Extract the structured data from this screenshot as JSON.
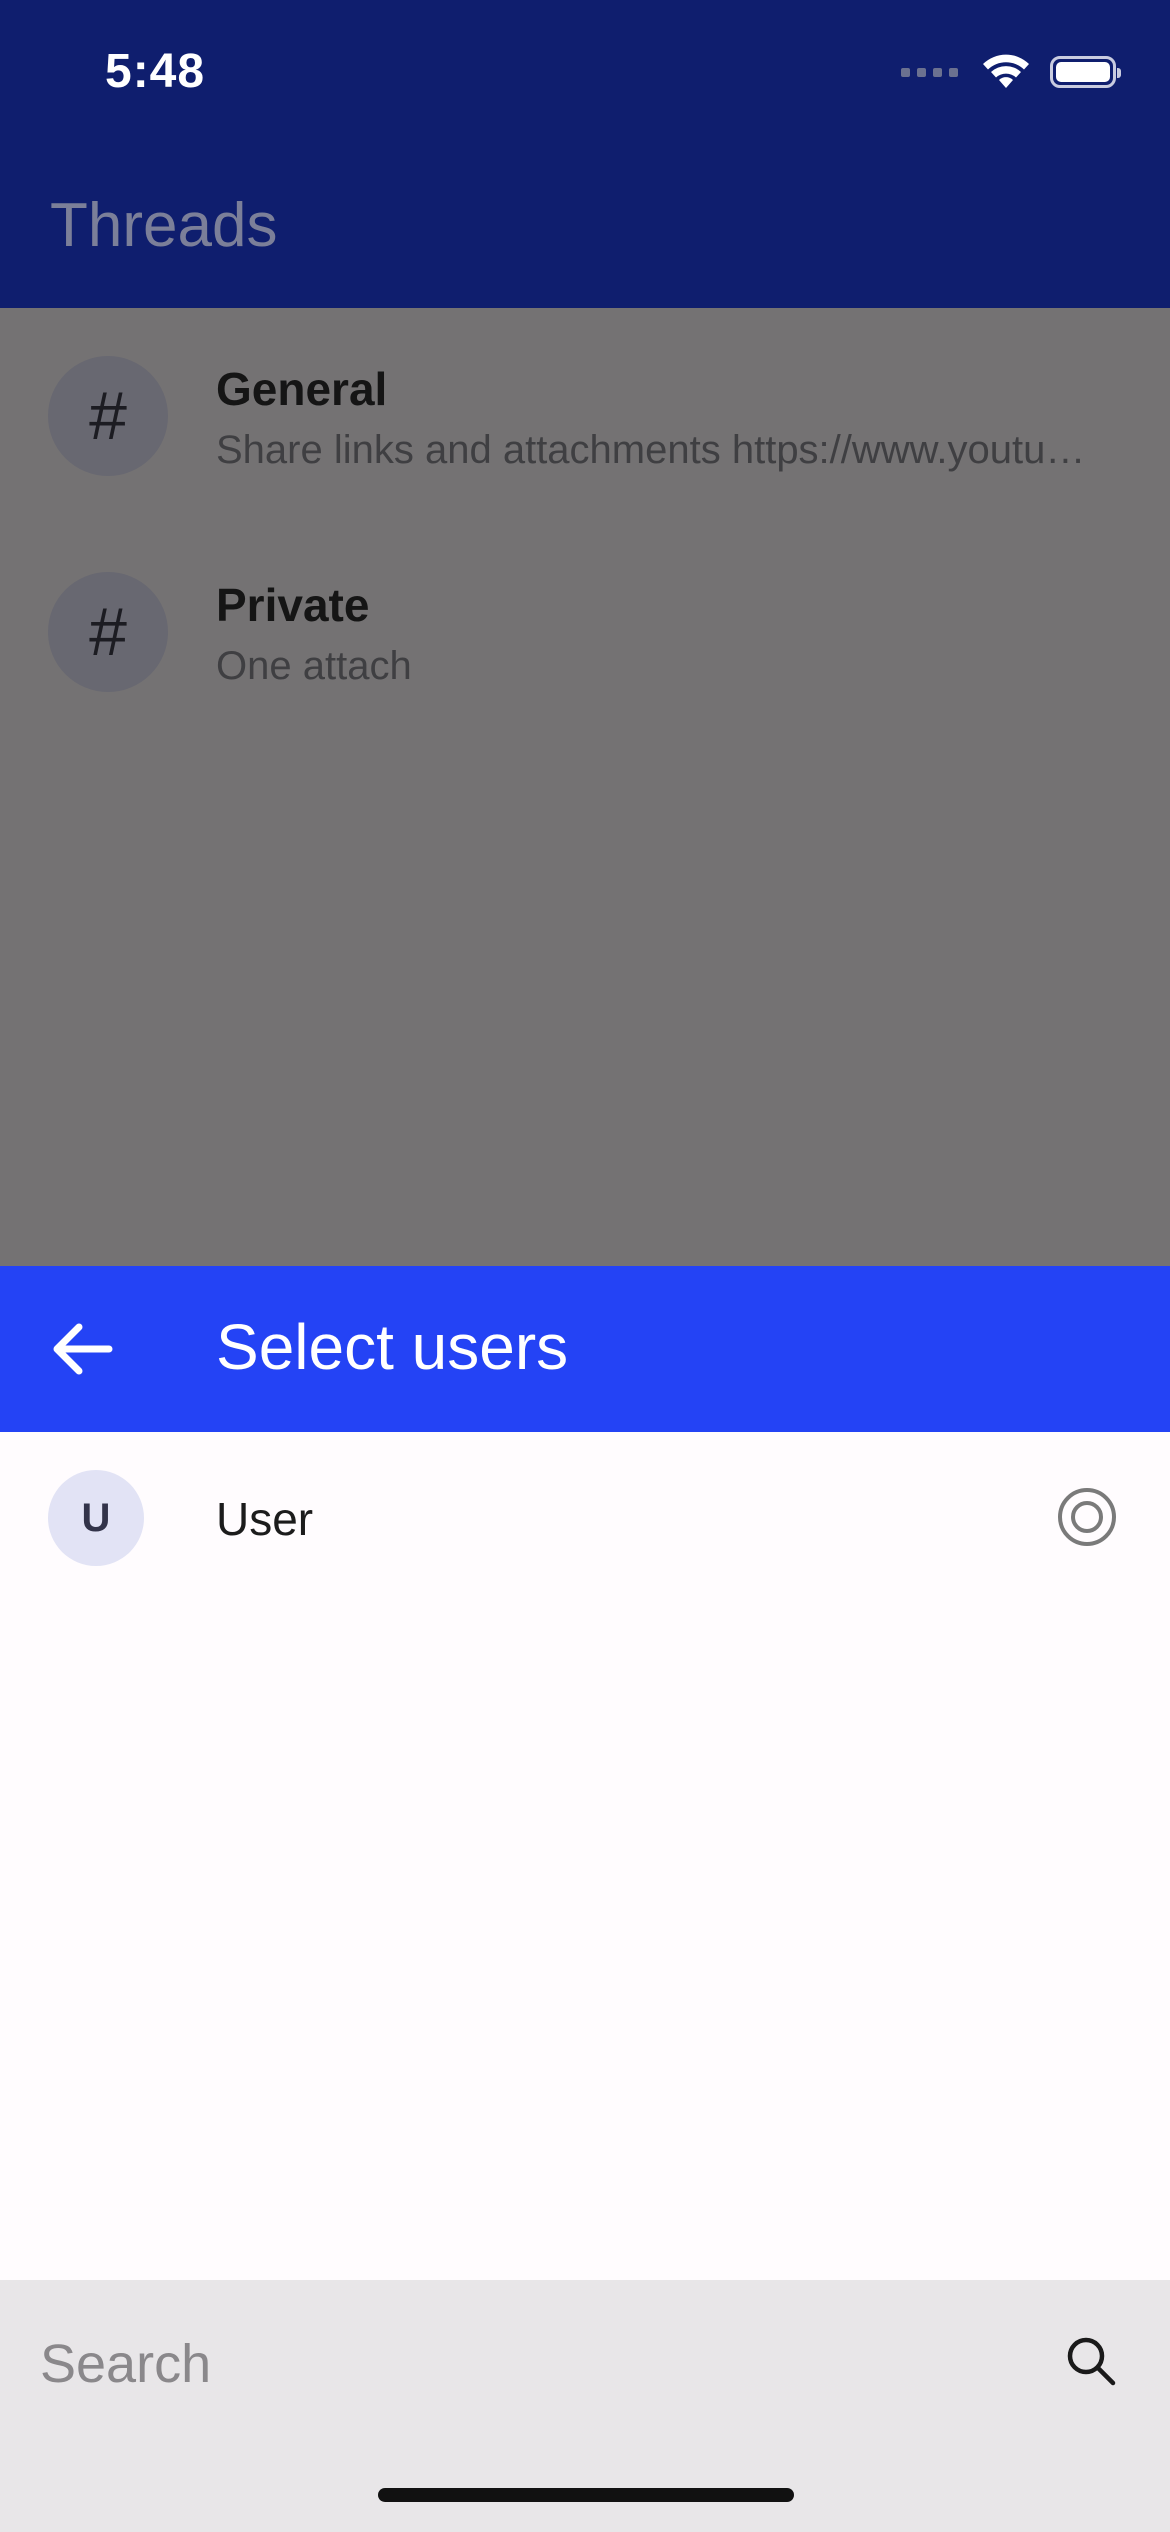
{
  "status_bar": {
    "time": "5:48"
  },
  "app_bar": {
    "title": "Threads"
  },
  "threads": [
    {
      "icon": "hash-icon",
      "symbol": "#",
      "title": "General",
      "subtitle": "Share links and attachments https://www.youtube.com/watch?v=..."
    },
    {
      "icon": "hash-icon",
      "symbol": "#",
      "title": "Private",
      "subtitle": "One attach"
    }
  ],
  "sheet": {
    "title": "Select users",
    "back_icon": "arrow-left-icon",
    "users": [
      {
        "initial": "U",
        "name": "User",
        "selection_icon": "radio-button-icon"
      }
    ]
  },
  "search": {
    "placeholder": "Search",
    "icon": "search-icon"
  },
  "colors": {
    "app_bar": "#0f1e6e",
    "sheet_header": "#2443f5",
    "scrim": "#747273",
    "sheet_body": "#fffcfe",
    "search_bar": "#e8e6e8"
  }
}
